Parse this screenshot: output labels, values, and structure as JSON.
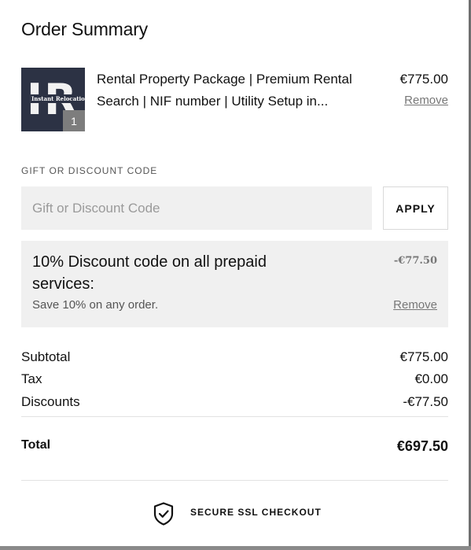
{
  "order_summary": {
    "title": "Order Summary"
  },
  "product": {
    "thumbnail_logo_letters": "IR",
    "thumbnail_logo_text": "Instant Relocation",
    "quantity": "1",
    "name": "Rental Property Package | Premium Rental Search | NIF number | Utility Setup in...",
    "price": "€775.00",
    "remove_label": "Remove"
  },
  "gift_code": {
    "label": "GIFT OR DISCOUNT CODE",
    "placeholder": "Gift or Discount Code",
    "value": "",
    "apply_label": "APPLY"
  },
  "discount": {
    "title": "10% Discount code on all prepaid services:",
    "description": "Save 10% on any order.",
    "amount": "-€77.50",
    "remove_label": "Remove"
  },
  "totals": {
    "subtotal_label": "Subtotal",
    "subtotal_value": "€775.00",
    "tax_label": "Tax",
    "tax_value": "€0.00",
    "discounts_label": "Discounts",
    "discounts_value": "-€77.50",
    "total_label": "Total",
    "total_value": "€697.50"
  },
  "secure": {
    "icon": "shield-check-icon",
    "label": "SECURE SSL CHECKOUT"
  },
  "colors": {
    "panel_background": "#f0f0f0",
    "thumbnail_background": "#2c3244",
    "muted_text": "#777777"
  }
}
